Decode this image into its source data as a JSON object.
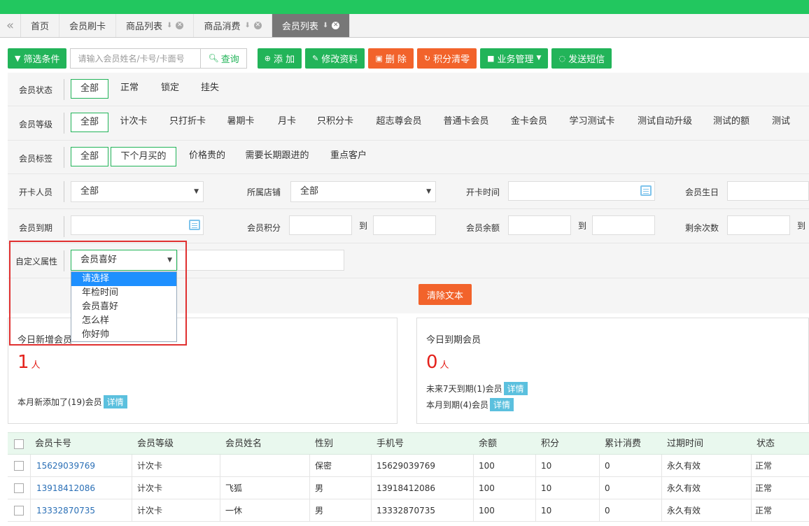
{
  "tabs": [
    {
      "label": "首页",
      "closable": false
    },
    {
      "label": "会员刷卡",
      "closable": false
    },
    {
      "label": "商品列表",
      "closable": true
    },
    {
      "label": "商品消费",
      "closable": true
    },
    {
      "label": "会员列表",
      "closable": true,
      "active": true
    }
  ],
  "toolbar": {
    "filter_label": "筛选条件",
    "search_placeholder": "请输入会员姓名/卡号/卡面号",
    "search_label": "查询",
    "add_label": "添 加",
    "edit_label": "修改资料",
    "delete_label": "删 除",
    "clear_points_label": "积分清零",
    "business_label": "业务管理",
    "sms_label": "发送短信"
  },
  "filters": {
    "status": {
      "label": "会员状态",
      "options": [
        "全部",
        "正常",
        "锁定",
        "挂失"
      ]
    },
    "level": {
      "label": "会员等级",
      "options": [
        "全部",
        "计次卡",
        "只打折卡",
        "暑期卡",
        "月卡",
        "只积分卡",
        "超志尊会员",
        "普通卡会员",
        "金卡会员",
        "学习测试卡",
        "测试自动升级",
        "测试的额",
        "测试"
      ]
    },
    "tags": {
      "label": "会员标签",
      "options": [
        "全部",
        "下个月买的",
        "价格贵的",
        "需要长期跟进的",
        "重点客户"
      ]
    },
    "opener": {
      "label": "开卡人员",
      "value": "全部"
    },
    "store": {
      "label": "所属店铺",
      "value": "全部"
    },
    "open_time": {
      "label": "开卡时间"
    },
    "birthday": {
      "label": "会员生日"
    },
    "expire": {
      "label": "会员到期"
    },
    "points": {
      "label": "会员积分",
      "to": "到"
    },
    "balance": {
      "label": "会员余额",
      "to": "到"
    },
    "remaining": {
      "label": "剩余次数",
      "to": "到"
    },
    "custom": {
      "label": "自定义属性",
      "value": "会员喜好",
      "dropdown": [
        "请选择",
        "年检时间",
        "会员喜好",
        "怎么样",
        "你好帅"
      ]
    },
    "clear_text": "清除文本"
  },
  "cards": {
    "new_today": {
      "title": "今日新增会员",
      "count": "1",
      "unit": "人",
      "note": "本月新添加了(19)会员",
      "detail": "详情"
    },
    "expire_today": {
      "title": "今日到期会员",
      "count": "0",
      "unit": "人",
      "note1": "未来7天到期(1)会员",
      "note2": "本月到期(4)会员",
      "detail": "详情"
    }
  },
  "table": {
    "headers": [
      "会员卡号",
      "会员等级",
      "会员姓名",
      "性别",
      "手机号",
      "余额",
      "积分",
      "累计消费",
      "过期时间",
      "状态"
    ],
    "rows": [
      [
        "15629039769",
        "计次卡",
        "",
        "保密",
        "15629039769",
        "100",
        "10",
        "0",
        "永久有效",
        "正常"
      ],
      [
        "13918412086",
        "计次卡",
        "飞狐",
        "男",
        "13918412086",
        "100",
        "10",
        "0",
        "永久有效",
        "正常"
      ],
      [
        "13332870735",
        "计次卡",
        "一休",
        "男",
        "13332870735",
        "100",
        "10",
        "0",
        "永久有效",
        "正常"
      ]
    ]
  },
  "colors": {
    "green": "#22b459",
    "orange": "#f2632b",
    "topbar": "#22c75f",
    "highlight": "#e03030"
  }
}
